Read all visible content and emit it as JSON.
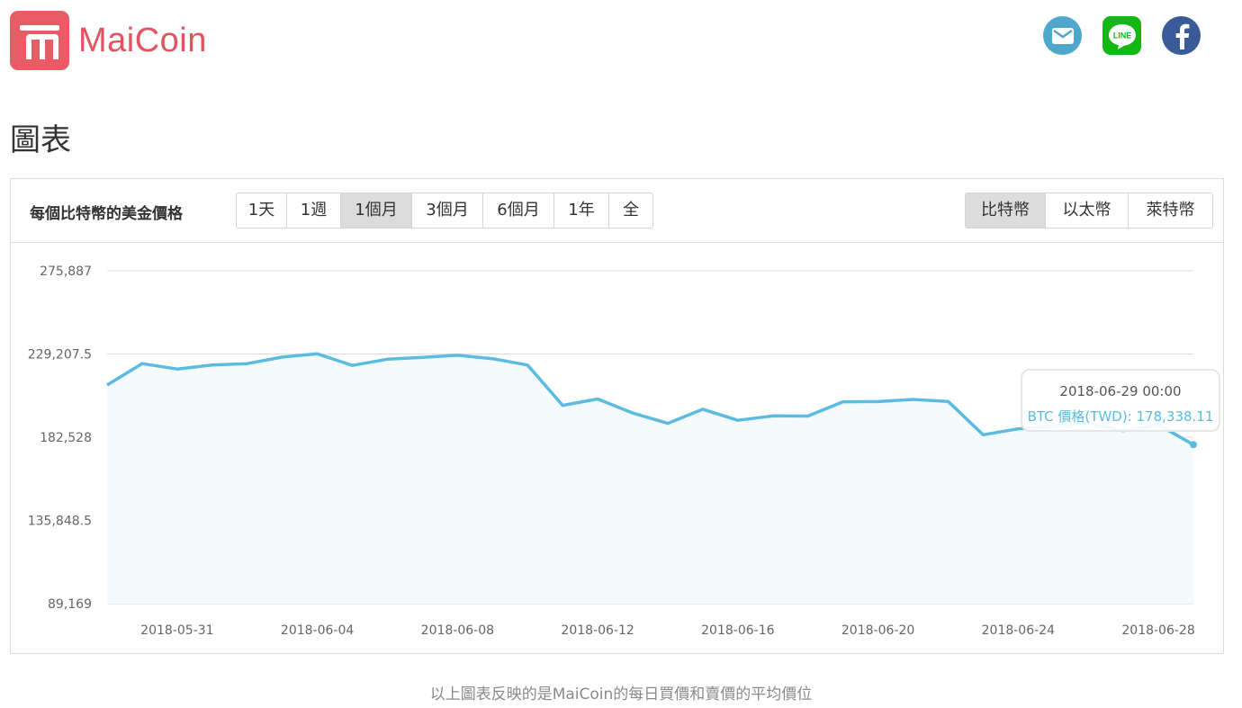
{
  "brand": {
    "name": "MaiCoin",
    "color": "#e95b65"
  },
  "social": [
    {
      "name": "mail-icon",
      "color": "#4fa8cc"
    },
    {
      "name": "line-icon",
      "label": "LINE",
      "color": "#13b814"
    },
    {
      "name": "facebook-icon",
      "color": "#3b5a98"
    }
  ],
  "page": {
    "title": "圖表"
  },
  "panel": {
    "label": "每個比特幣的美金價格",
    "ranges": [
      "1天",
      "1週",
      "1個月",
      "3個月",
      "6個月",
      "1年",
      "全"
    ],
    "active_range": "1個月",
    "coins": [
      "比特幣",
      "以太幣",
      "萊特幣"
    ],
    "active_coin": "比特幣"
  },
  "tooltip": {
    "date": "2018-06-29 00:00",
    "value": "BTC 價格(TWD): 178,338.11"
  },
  "footnote": "以上圖表反映的是MaiCoin的每日買價和賣價的平均價位",
  "chart_data": {
    "type": "area",
    "line_color": "#5bbce0",
    "fill_color": "#f5fafd",
    "x": [
      "2018-05-29",
      "2018-05-30",
      "2018-05-31",
      "2018-06-01",
      "2018-06-02",
      "2018-06-03",
      "2018-06-04",
      "2018-06-05",
      "2018-06-06",
      "2018-06-07",
      "2018-06-08",
      "2018-06-09",
      "2018-06-10",
      "2018-06-11",
      "2018-06-12",
      "2018-06-13",
      "2018-06-14",
      "2018-06-15",
      "2018-06-16",
      "2018-06-17",
      "2018-06-18",
      "2018-06-19",
      "2018-06-20",
      "2018-06-21",
      "2018-06-22",
      "2018-06-23",
      "2018-06-24",
      "2018-06-25",
      "2018-06-26",
      "2018-06-27",
      "2018-06-28",
      "2018-06-29"
    ],
    "series": [
      {
        "values": [
          211800,
          223800,
          220800,
          223000,
          223800,
          227500,
          229300,
          222800,
          226300,
          227300,
          228500,
          226600,
          223000,
          200400,
          204000,
          196100,
          190300,
          198200,
          192000,
          194500,
          194400,
          202400,
          202500,
          203700,
          202600,
          183900,
          187200,
          188700,
          190800,
          186200,
          189500,
          178338.11
        ]
      }
    ],
    "x_ticks": [
      "2018-05-31",
      "2018-06-04",
      "2018-06-08",
      "2018-06-12",
      "2018-06-16",
      "2018-06-20",
      "2018-06-24",
      "2018-06-28"
    ],
    "y_ticks": [
      "89,169",
      "135,848.5",
      "182,528",
      "229,207.5",
      "275,887"
    ],
    "ylim": [
      89169,
      275887
    ],
    "grid": true,
    "legend": "none"
  }
}
